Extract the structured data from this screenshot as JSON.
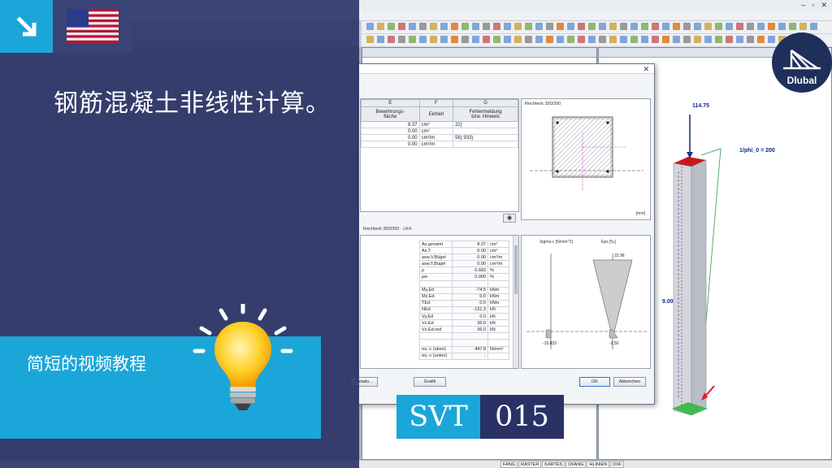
{
  "video": {
    "title": "钢筋混凝土非线性计算。",
    "subtitle": "简短的视频教程",
    "series_label": "SVT",
    "series_number": "015",
    "brand": "Dlubal"
  },
  "dialog": {
    "close_glyph": "✕",
    "table": {
      "col_letters": [
        "E",
        "F",
        "G"
      ],
      "headers": [
        "Bewehrungs-\nfläche",
        "Einheit",
        "Fehlermeldung\nbzw. Hinweis"
      ],
      "rows": [
        {
          "value": "8.37",
          "unit": "cm²",
          "note": "22)"
        },
        {
          "value": "0.00",
          "unit": "cm²",
          "note": ""
        },
        {
          "value": "0.00",
          "unit": "cm²/m",
          "note": "58) 933)"
        },
        {
          "value": "0.00",
          "unit": "cm²/m",
          "note": ""
        }
      ]
    },
    "section_panel": {
      "title": "Rechteck 350/350",
      "unit": "[mm]"
    },
    "results_header": "Rechteck 350/350  ·  LK4",
    "results": [
      {
        "name": "As,gesamt",
        "value": "8.37",
        "unit": "cm²"
      },
      {
        "name": "As,T",
        "value": "0.00",
        "unit": "cm²"
      },
      {
        "name": "asw,V,Bügel",
        "value": "0.00",
        "unit": "cm²/m"
      },
      {
        "name": "asw,T,Bügel",
        "value": "0.00",
        "unit": "cm²/m"
      },
      {
        "name": "ρ",
        "value": "0.683",
        "unit": "%"
      },
      {
        "name": "ρw",
        "value": "0.000",
        "unit": "%"
      },
      {
        "name": "",
        "value": "",
        "unit": ""
      },
      {
        "name": "My,Ed",
        "value": "-74.5",
        "unit": "kNm"
      },
      {
        "name": "Mz,Ed",
        "value": "0.0",
        "unit": "kNm"
      },
      {
        "name": "TEd",
        "value": "0.0",
        "unit": "kNm"
      },
      {
        "name": "NEd",
        "value": "-131.3",
        "unit": "kN"
      },
      {
        "name": "Vy,Ed",
        "value": "0.0",
        "unit": "kN"
      },
      {
        "name": "Vz,Ed",
        "value": "36.0",
        "unit": "kN"
      },
      {
        "name": "Vz,Ed,red",
        "value": "36.0",
        "unit": "kN"
      },
      {
        "name": "",
        "value": "",
        "unit": ""
      },
      {
        "name": "",
        "value": "",
        "unit": ""
      },
      {
        "name": "σs,-c (oben)",
        "value": "447.8",
        "unit": "N/mm²"
      },
      {
        "name": "σs,-c (unten)",
        "value": "-",
        "unit": ""
      }
    ],
    "diagram": {
      "label_sigma": "Sigma-c [N/mm^2]",
      "label_eps": "Eps [‰]",
      "eps_top": "22.96",
      "sigma_bottom": "-15.833",
      "eps_bottom": "-3.50"
    },
    "buttons": {
      "details": "Details...",
      "graphics": "Grafik",
      "ok": "OK",
      "cancel": "Abbrechen"
    }
  },
  "model_view": {
    "load_value": "114.75",
    "phi_label": "1/phi_0 = 200",
    "height_label": "9.00"
  },
  "statusbar": [
    "FANG",
    "RASTER",
    "KARTES",
    "OFANG",
    "HLINIEN",
    "DXF"
  ],
  "colors": {
    "overlay": "#242c60",
    "accent_cyan": "#1ba6d9",
    "svt_dark": "#293165",
    "logo_bg": "#1f2f5c"
  }
}
